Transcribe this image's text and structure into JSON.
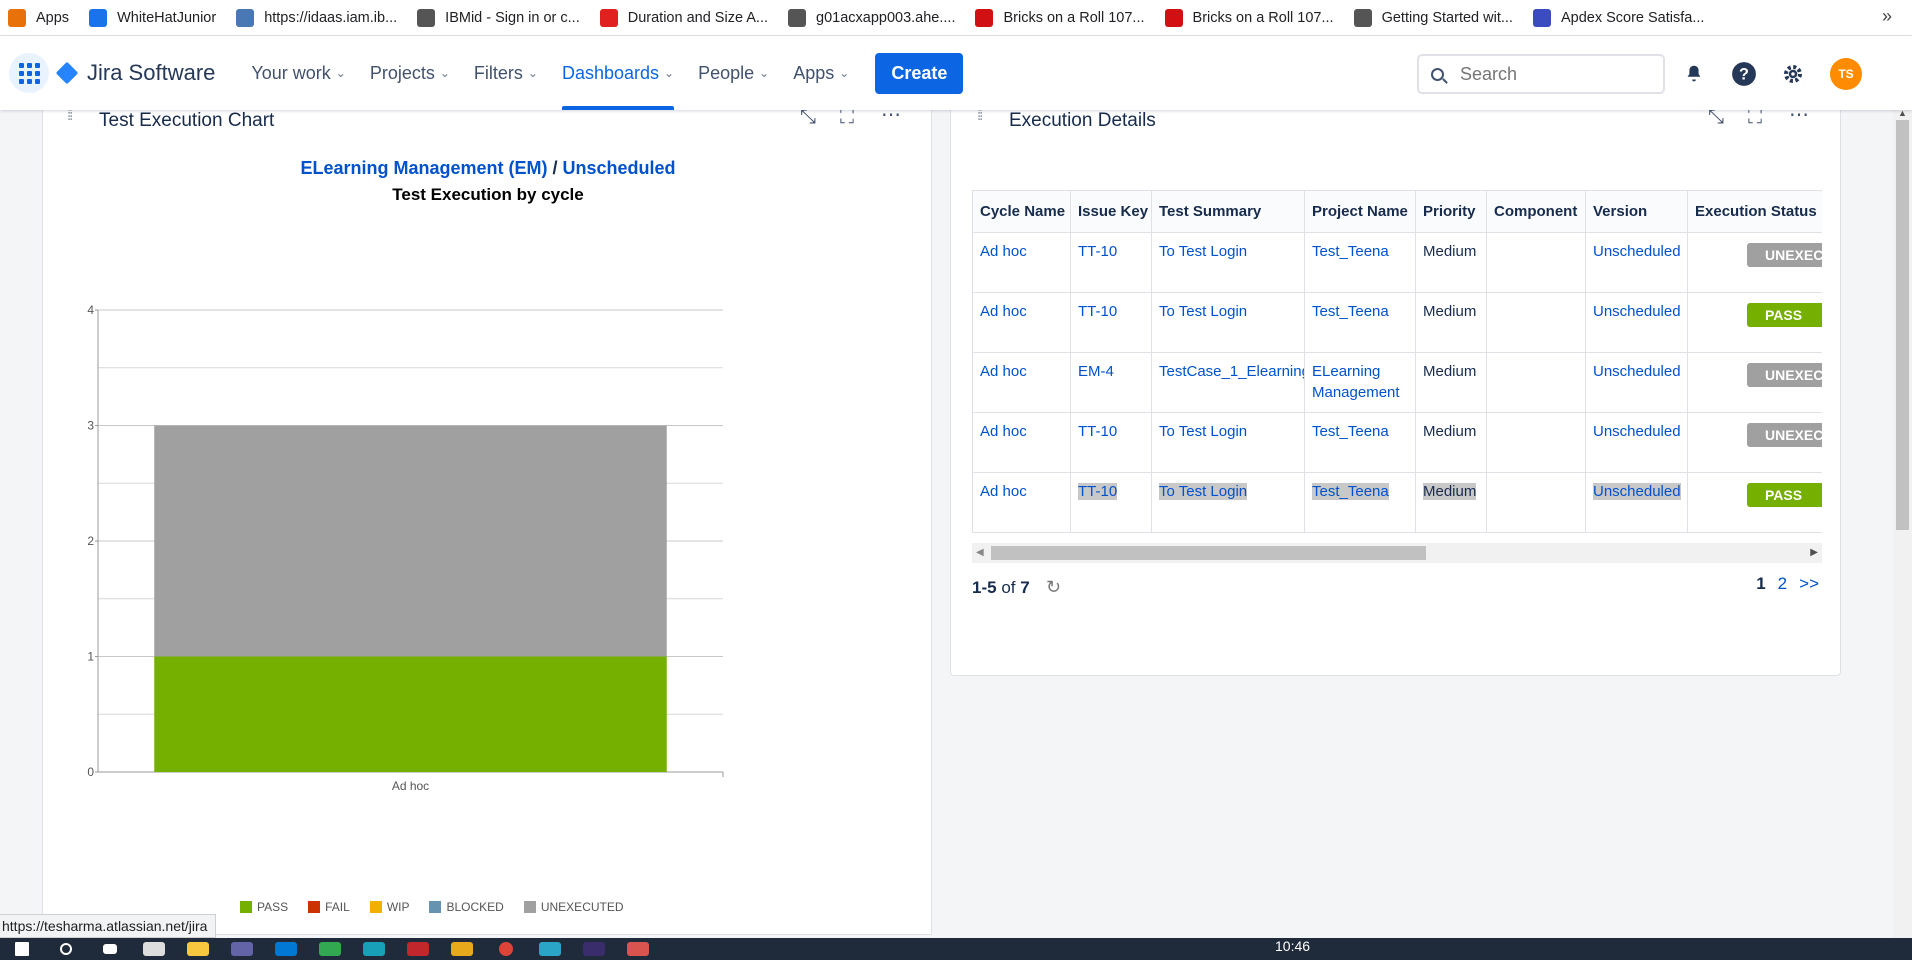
{
  "bookmarks": [
    {
      "label": "Apps",
      "icon": "apps-grid-icon",
      "color": "#e8710a"
    },
    {
      "label": "WhiteHatJunior",
      "icon": "whitehat-icon",
      "color": "#1a73e8"
    },
    {
      "label": "https://idaas.iam.ib...",
      "icon": "document-icon",
      "color": "#4a78b5"
    },
    {
      "label": "IBMid - Sign in or c...",
      "icon": "ibm-icon",
      "color": "#555555"
    },
    {
      "label": "Duration and Size A...",
      "icon": "opera-icon",
      "color": "#e0211f"
    },
    {
      "label": "g01acxapp003.ahe....",
      "icon": "globe-icon",
      "color": "#555555"
    },
    {
      "label": "Bricks on a Roll 107...",
      "icon": "lego-icon",
      "color": "#d01012"
    },
    {
      "label": "Bricks on a Roll 107...",
      "icon": "lego-icon",
      "color": "#d01012"
    },
    {
      "label": "Getting Started wit...",
      "icon": "globe-icon",
      "color": "#555555"
    },
    {
      "label": "Apdex Score Satisfa...",
      "icon": "page-icon",
      "color": "#3b4cc0"
    }
  ],
  "bookmarks_more": "»",
  "nav": {
    "product": "Jira Software",
    "items": [
      {
        "label": "Your work",
        "active": false
      },
      {
        "label": "Projects",
        "active": false
      },
      {
        "label": "Filters",
        "active": false
      },
      {
        "label": "Dashboards",
        "active": true
      },
      {
        "label": "People",
        "active": false
      },
      {
        "label": "Apps",
        "active": false
      }
    ],
    "create": "Create",
    "search_placeholder": "Search",
    "avatar_initials": "TS"
  },
  "chart_gadget": {
    "title": "Test Execution Chart",
    "project_link": "ELearning Management (EM)",
    "separator": "/",
    "version_link": "Unscheduled",
    "subtitle": "Test Execution by cycle"
  },
  "chart_data": {
    "type": "bar",
    "stacked": true,
    "categories": [
      "Ad hoc"
    ],
    "series": [
      {
        "name": "PASS",
        "values": [
          1
        ],
        "color": "#75b000"
      },
      {
        "name": "FAIL",
        "values": [
          0
        ],
        "color": "#cc3300"
      },
      {
        "name": "WIP",
        "values": [
          0
        ],
        "color": "#f2b000"
      },
      {
        "name": "BLOCKED",
        "values": [
          0
        ],
        "color": "#6693b0"
      },
      {
        "name": "UNEXECUTED",
        "values": [
          2
        ],
        "color": "#a0a0a0"
      }
    ],
    "ylim": [
      0,
      4
    ],
    "yticks": [
      "0",
      "1",
      "2",
      "3",
      "4"
    ],
    "grid": true,
    "legend": "bottom"
  },
  "details_gadget": {
    "title": "Execution Details",
    "columns": [
      "Cycle Name",
      "Issue Key",
      "Test Summary",
      "Project Name",
      "Priority",
      "Component",
      "Version",
      "Execution Status"
    ],
    "rows": [
      {
        "cycle": "Ad hoc",
        "key": "TT-10",
        "summary": "To Test Login",
        "project": "Test_Teena",
        "priority": "Medium",
        "component": "",
        "version": "Unscheduled",
        "status": "UNEXECUTED",
        "status_color": "#a0a0a0"
      },
      {
        "cycle": "Ad hoc",
        "key": "TT-10",
        "summary": "To Test Login",
        "project": "Test_Teena",
        "priority": "Medium",
        "component": "",
        "version": "Unscheduled",
        "status": "PASS",
        "status_color": "#75b000"
      },
      {
        "cycle": "Ad hoc",
        "key": "EM-4",
        "summary": "TestCase_1_Elearning",
        "project": "ELearning Management",
        "priority": "Medium",
        "component": "",
        "version": "Unscheduled",
        "status": "UNEXECUTED",
        "status_color": "#a0a0a0"
      },
      {
        "cycle": "Ad hoc",
        "key": "TT-10",
        "summary": "To Test Login",
        "project": "Test_Teena",
        "priority": "Medium",
        "component": "",
        "version": "Unscheduled",
        "status": "UNEXECUTED",
        "status_color": "#a0a0a0"
      },
      {
        "cycle": "Ad hoc",
        "key": "TT-10",
        "summary": "To Test Login",
        "project": "Test_Teena",
        "priority": "Medium",
        "component": "",
        "version": "Unscheduled",
        "status": "PASS",
        "status_color": "#75b000"
      }
    ],
    "range": "1-5",
    "of": "of",
    "total": "7",
    "pages": [
      "1",
      "2",
      ">>"
    ]
  },
  "status_url": "https://tesharma.atlassian.net/jira",
  "clock": "10:46"
}
